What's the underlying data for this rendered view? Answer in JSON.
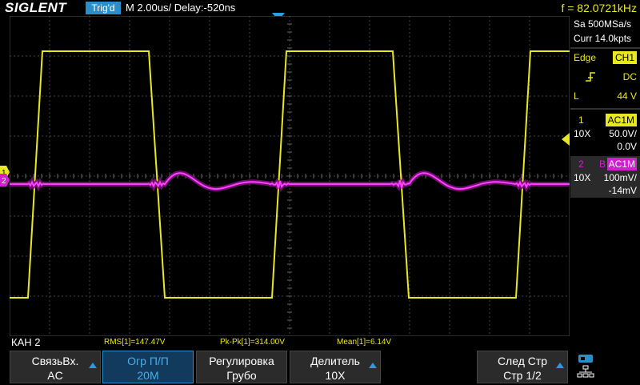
{
  "topbar": {
    "logo": "SIGLENT",
    "trigger_status": "Trig'd",
    "timebase": "M 2.00us/  Delay:-520ns",
    "frequency": "f = 82.0721kHz"
  },
  "panel": {
    "sample_rate": "Sa 500MSa/s",
    "memory_depth": "Curr 14.0kpts",
    "trigger": {
      "type": "Edge",
      "source": "CH1",
      "coupling": "DC",
      "level_label": "L",
      "level": "44 V"
    },
    "ch1": {
      "number": "1",
      "coupling": "AC1M",
      "probe": "10X",
      "scale": "50.0V/",
      "offset": "0.0V"
    },
    "ch2": {
      "number": "2",
      "bw": "B",
      "coupling": "AC1M",
      "probe": "10X",
      "scale": "100mV/",
      "offset": "-14mV"
    }
  },
  "measurements": {
    "menu_channel": "КАН 2",
    "rms": "RMS[1]=147.47V",
    "pkpk": "Pk-Pk[1]=314.00V",
    "mean": "Mean[1]=6.14V"
  },
  "softkeys": [
    {
      "line1": "СвязьВх.",
      "line2": "AC"
    },
    {
      "line1": "Огр П/П",
      "line2": "20M"
    },
    {
      "line1": "Регулировка",
      "line2": "Грубо"
    },
    {
      "line1": "Делитель",
      "line2": "10X"
    },
    {
      "line1": "",
      "line2": ""
    },
    {
      "line1": "След Стр",
      "line2": "Стр 1/2"
    }
  ],
  "colors": {
    "ch1": "#e8e820",
    "ch2": "#d020d0",
    "accent": "#2a8fc9"
  },
  "icons": [
    "usb-icon",
    "network-icon"
  ]
}
